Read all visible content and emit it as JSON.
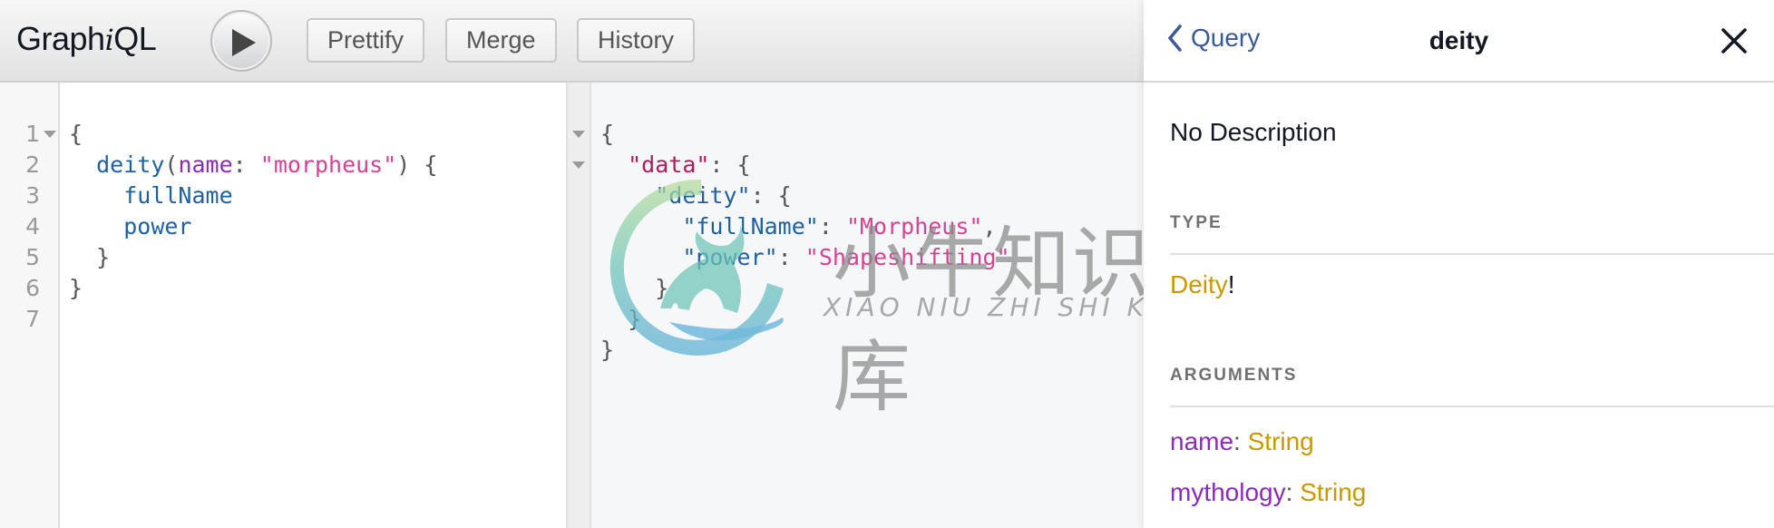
{
  "toolbar": {
    "title_pre": "Graph",
    "title_i": "i",
    "title_post": "QL",
    "execute_icon": "play-icon",
    "buttons": {
      "prettify": "Prettify",
      "merge": "Merge",
      "history": "History"
    }
  },
  "query_editor": {
    "line_numbers": [
      "1",
      "2",
      "3",
      "4",
      "5",
      "6",
      "7"
    ],
    "lines": [
      [
        {
          "t": "{",
          "c": "punc"
        }
      ],
      [
        {
          "t": "  ",
          "c": "punc"
        },
        {
          "t": "deity",
          "c": "field"
        },
        {
          "t": "(",
          "c": "punc"
        },
        {
          "t": "name",
          "c": "arg"
        },
        {
          "t": ": ",
          "c": "punc"
        },
        {
          "t": "\"morpheus\"",
          "c": "str"
        },
        {
          "t": ") {",
          "c": "punc"
        }
      ],
      [
        {
          "t": "    ",
          "c": "punc"
        },
        {
          "t": "fullName",
          "c": "field"
        }
      ],
      [
        {
          "t": "    ",
          "c": "punc"
        },
        {
          "t": "power",
          "c": "field"
        }
      ],
      [
        {
          "t": "  }",
          "c": "punc"
        }
      ],
      [
        {
          "t": "}",
          "c": "punc"
        }
      ],
      []
    ]
  },
  "results": {
    "lines": [
      [
        {
          "t": "{",
          "c": "punc"
        }
      ],
      [
        {
          "t": "  ",
          "c": "punc"
        },
        {
          "t": "\"data\"",
          "c": "key"
        },
        {
          "t": ": {",
          "c": "punc"
        }
      ],
      [
        {
          "t": "    ",
          "c": "punc"
        },
        {
          "t": "\"deity\"",
          "c": "field"
        },
        {
          "t": ": {",
          "c": "punc"
        }
      ],
      [
        {
          "t": "      ",
          "c": "punc"
        },
        {
          "t": "\"fullName\"",
          "c": "field"
        },
        {
          "t": ": ",
          "c": "punc"
        },
        {
          "t": "\"Morpheus\"",
          "c": "str"
        },
        {
          "t": ",",
          "c": "punc"
        }
      ],
      [
        {
          "t": "      ",
          "c": "punc"
        },
        {
          "t": "\"power\"",
          "c": "field"
        },
        {
          "t": ": ",
          "c": "punc"
        },
        {
          "t": "\"Shapeshifting\"",
          "c": "str"
        }
      ],
      [
        {
          "t": "    }",
          "c": "punc"
        }
      ],
      [
        {
          "t": "  }",
          "c": "punc"
        }
      ],
      [
        {
          "t": "}",
          "c": "punc"
        }
      ]
    ]
  },
  "watermark": {
    "chinese": "小牛知识库",
    "pinyin": "XIAO NIU ZHI SHI KU"
  },
  "doc_explorer": {
    "back_label": "Query",
    "title": "deity",
    "description": "No Description",
    "type_section": "TYPE",
    "type_name": "Deity",
    "type_suffix": "!",
    "arguments_section": "ARGUMENTS",
    "arguments": [
      {
        "name": "name",
        "type": "String"
      },
      {
        "name": "mythology",
        "type": "String"
      }
    ]
  },
  "colors": {
    "field": "#1f61a0",
    "arg": "#8b2bb9",
    "string": "#d64292",
    "key": "#b11a5c",
    "type": "#ca9800",
    "link": "#3b5998"
  }
}
